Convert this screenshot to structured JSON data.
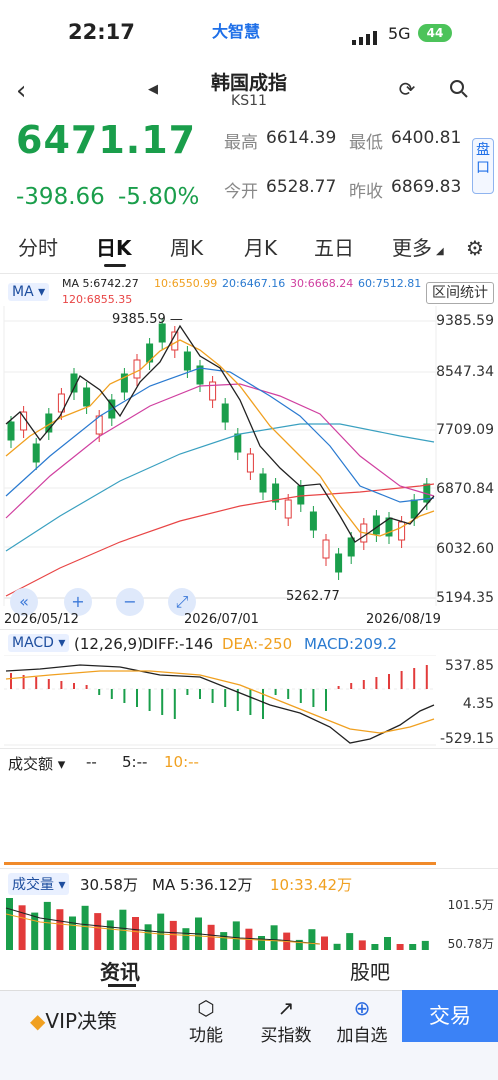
{
  "status": {
    "time": "22:17",
    "network": "5G",
    "battery": "44",
    "app_logo": "大智慧"
  },
  "header": {
    "title": "韩国成指",
    "code": "KS11",
    "back_icon": "back-icon",
    "refresh_icon": "refresh-icon",
    "search_icon": "search-icon"
  },
  "quote": {
    "price": "6471.17",
    "change": "-398.66",
    "change_pct": "-5.80%",
    "high_label": "最高",
    "high": "6614.39",
    "low_label": "最低",
    "low": "6400.81",
    "open_label": "今开",
    "open": "6528.77",
    "prev_close_label": "昨收",
    "prev_close": "6869.83",
    "pankou": "盘口"
  },
  "tabs": [
    "分时",
    "日K",
    "周K",
    "月K",
    "五日",
    "更多"
  ],
  "active_tab": "日K",
  "kline": {
    "indicator": "MA",
    "ma_title": "MA 5:6742.27",
    "ma10": "10:6550.99",
    "ma20": "20:6467.16",
    "ma30": "30:6668.24",
    "ma60": "60:7512.81",
    "ma120": "120:6855.35",
    "range_button": "区间统计",
    "y_labels": [
      "9385.59",
      "8547.34",
      "7709.09",
      "6870.84",
      "6032.60",
      "5194.35"
    ],
    "max_marker": "9385.59",
    "min_marker": "5262.77",
    "dates": [
      "2026/05/12",
      "2026/07/01",
      "2026/08/19"
    ]
  },
  "macd": {
    "name": "MACD",
    "params": "(12,26,9)",
    "diff": "DIFF:-146",
    "dea": "DEA:-250",
    "macd": "MACD:209.2",
    "y_labels": [
      "537.85",
      "4.35",
      "-529.15"
    ]
  },
  "turnover": {
    "name": "成交额",
    "v1": "--",
    "v5": "5:--",
    "v10": "10:--"
  },
  "volume": {
    "name": "成交量",
    "value": "30.58万",
    "ma5": "MA 5:36.12万",
    "ma10": "10:33.42万",
    "y_labels": [
      "101.5万",
      "50.78万"
    ]
  },
  "bottom_tabs": [
    "资讯",
    "股吧"
  ],
  "toolbar": {
    "vip": "VIP决策",
    "func": "功能",
    "buy_index": "买指数",
    "add_fav": "加自选",
    "trade": "交易"
  },
  "colors": {
    "up": "#e23b3b",
    "down": "#1a9e4b",
    "ma5": "#222222",
    "ma10": "#f0a020",
    "ma20": "#2aa0c8",
    "ma30": "#d040a0",
    "ma60": "#3aa0c0",
    "ma120": "#e84545"
  }
}
